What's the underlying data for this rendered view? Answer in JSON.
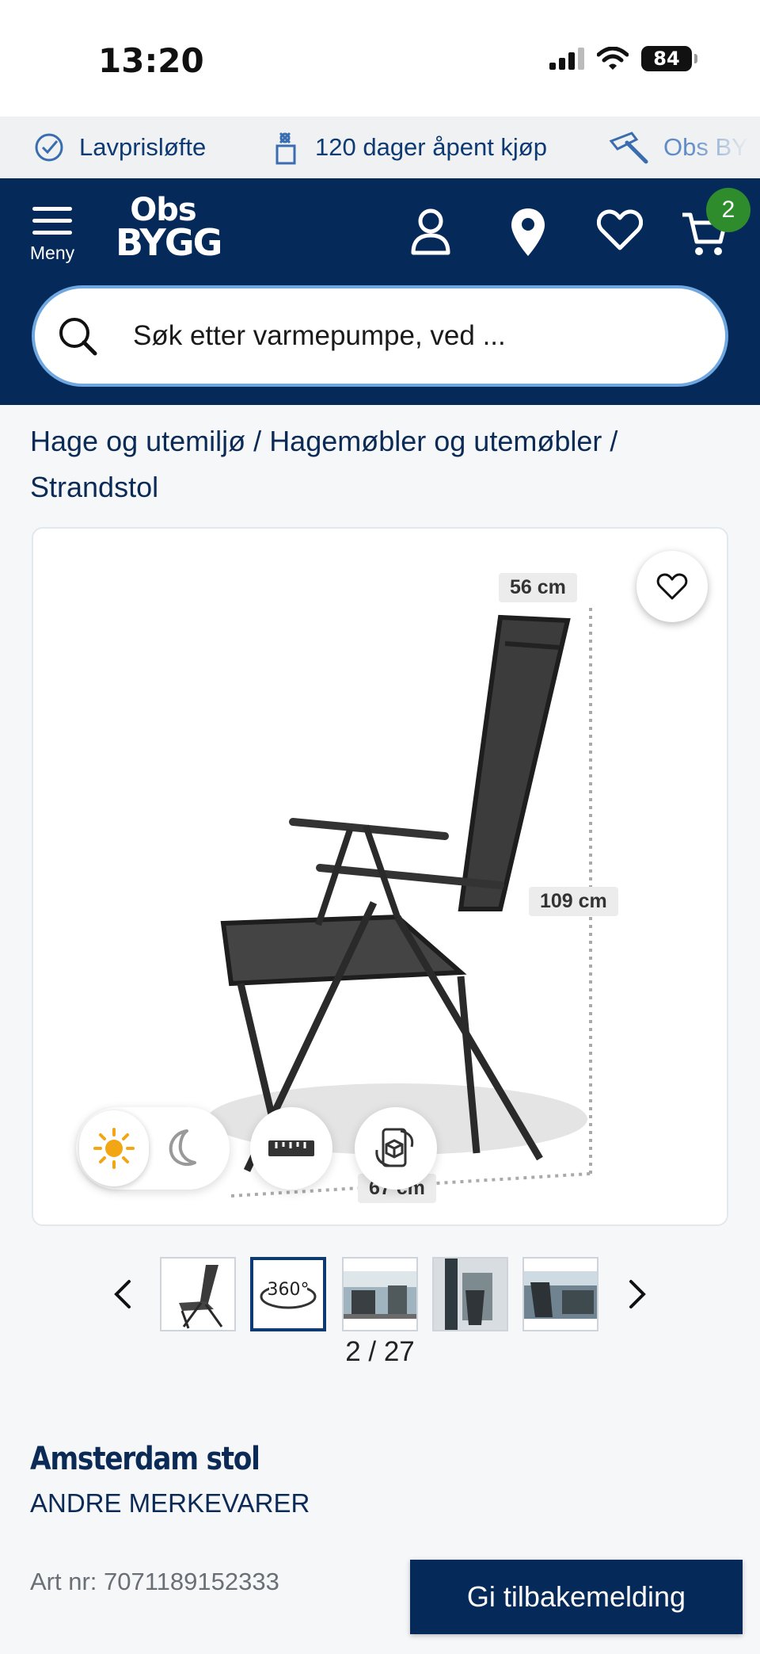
{
  "status_bar": {
    "time": "13:20",
    "battery": "84"
  },
  "usp": [
    {
      "label": "Lavprisløfte",
      "icon": "check-circle-icon"
    },
    {
      "label": "120 dager åpent kjøp",
      "icon": "gift-icon"
    },
    {
      "label": "Obs BYGG",
      "icon": "hammer-icon"
    }
  ],
  "header": {
    "menu_label": "Meny",
    "logo_top": "Obs",
    "logo_bottom": "BYGG",
    "cart_count": "2",
    "colors": {
      "background": "#052a5a",
      "badge": "#2f8c2d"
    }
  },
  "search": {
    "placeholder": "Søk etter varmepumpe, ved ..."
  },
  "breadcrumb": {
    "items": [
      "Hage og utemiljø",
      "Hagemøbler og utemøbler",
      "Strandstol"
    ],
    "separator": "/"
  },
  "gallery": {
    "dimensions": {
      "depth": "56 cm",
      "height": "109 cm",
      "width": "67 cm"
    },
    "controls": [
      "sun-icon",
      "moon-icon",
      "ruler-icon",
      "ar-3d-icon"
    ],
    "thumbnail_count_visible": 5,
    "active_thumbnail_label": "360°",
    "counter": "2 / 27"
  },
  "product": {
    "name": "Amsterdam stol",
    "brand": "ANDRE MERKEVARER",
    "art_nr": "Art nr: 7071189152333"
  },
  "feedback_button": {
    "label": "Gi tilbakemelding"
  }
}
